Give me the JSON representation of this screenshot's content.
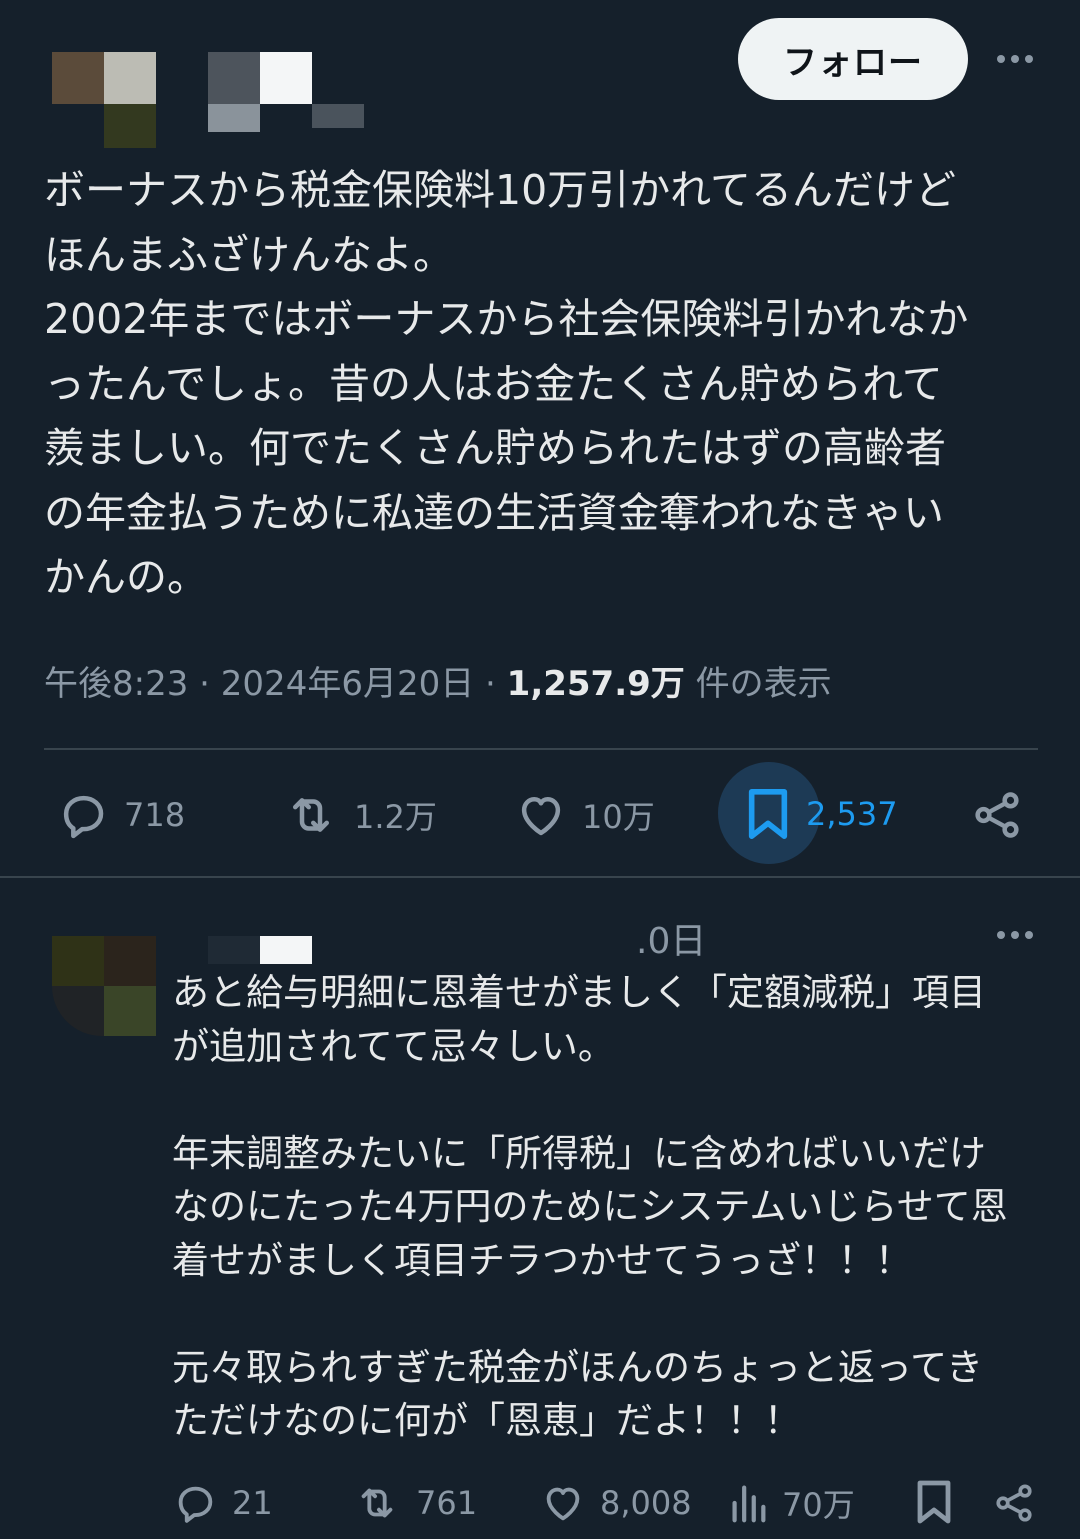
{
  "tweet": {
    "follow_label": "フォロー",
    "text": "ボーナスから税金保険料10万引かれてるんだけど\nほんまふざけんなよ。\n2002年まではボーナスから社会保険料引かれなか\nったんでしょ。昔の人はお金たくさん貯められて\n羨ましい。何でたくさん貯められたはずの高齢者\nの年金払うために私達の生活資金奪われなきゃい\nかんの。",
    "time": "午後8:23",
    "date": "2024年6月20日",
    "views_count": "1,257.9万",
    "views_label": "件の表示",
    "stats": {
      "replies": "718",
      "retweets": "1.2万",
      "likes": "10万",
      "bookmarks": "2,537"
    }
  },
  "reply": {
    "date_fragment": ".0日",
    "text": "あと給与明細に恩着せがましく「定額減税」項目\nが追加されてて忌々しい。\n\n年末調整みたいに「所得税」に含めればいいだけ\nなのにたった4万円のためにシステムいじらせて恩\n着せがましく項目チラつかせてうっざ！！！\n\n元々取られすぎた税金がほんのちょっと返ってき\nただけなのに何が「恩恵」だよ！！！",
    "stats": {
      "replies": "21",
      "retweets": "761",
      "likes": "8,008",
      "views": "70万"
    }
  },
  "colors": {
    "background": "#15202b",
    "text": "#e7e9ea",
    "muted": "#8b98a5",
    "accent": "#1d9bf0",
    "divider": "#38444d"
  }
}
